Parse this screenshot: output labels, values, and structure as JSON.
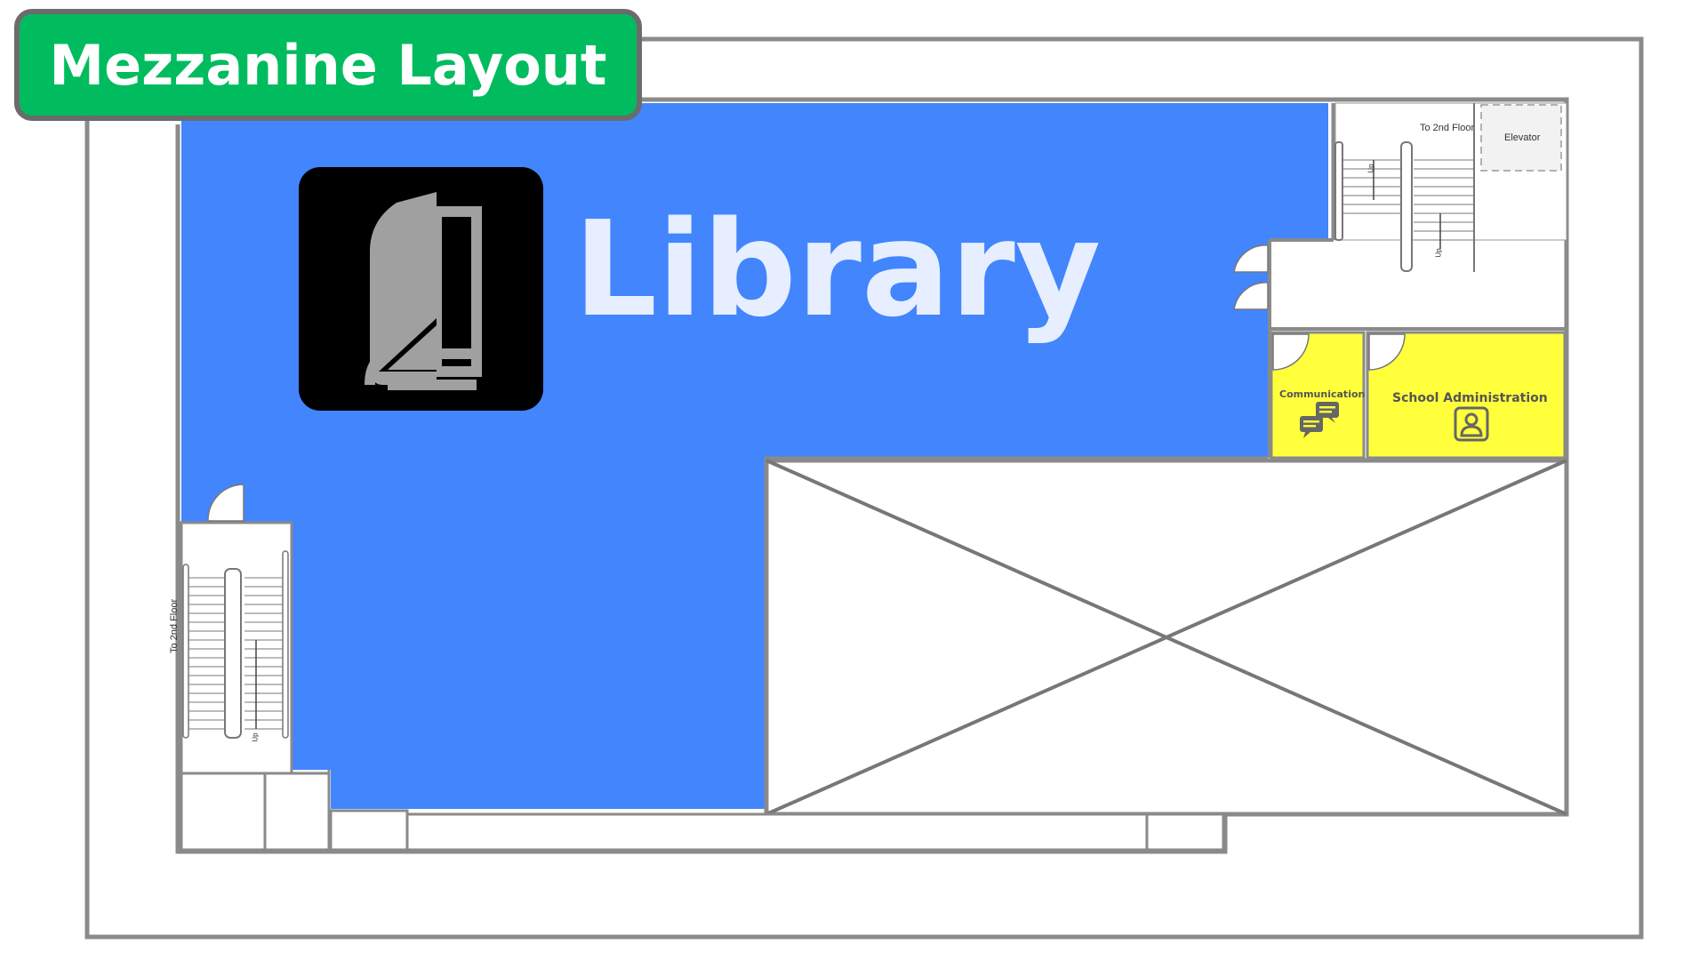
{
  "title": "Mezzanine Layout",
  "rooms": {
    "library": {
      "label": "Library",
      "color": "#4285fd",
      "icon": "book-icon"
    },
    "communication": {
      "label": "Communication",
      "color": "#ffff3c",
      "icon": "chat-bubbles-icon"
    },
    "school_admin": {
      "label": "School Administration",
      "color": "#ffff3c",
      "icon": "person-badge-icon"
    }
  },
  "stairs": {
    "north": {
      "label": "To 2nd Floor",
      "up": "Up"
    },
    "west": {
      "label": "To 2nd Floor",
      "up": "Up"
    }
  },
  "elevator": {
    "label": "Elevator"
  },
  "colors": {
    "title_bg": "#00bc5e",
    "wall": "#808080",
    "library_text": "#e6eeff"
  }
}
